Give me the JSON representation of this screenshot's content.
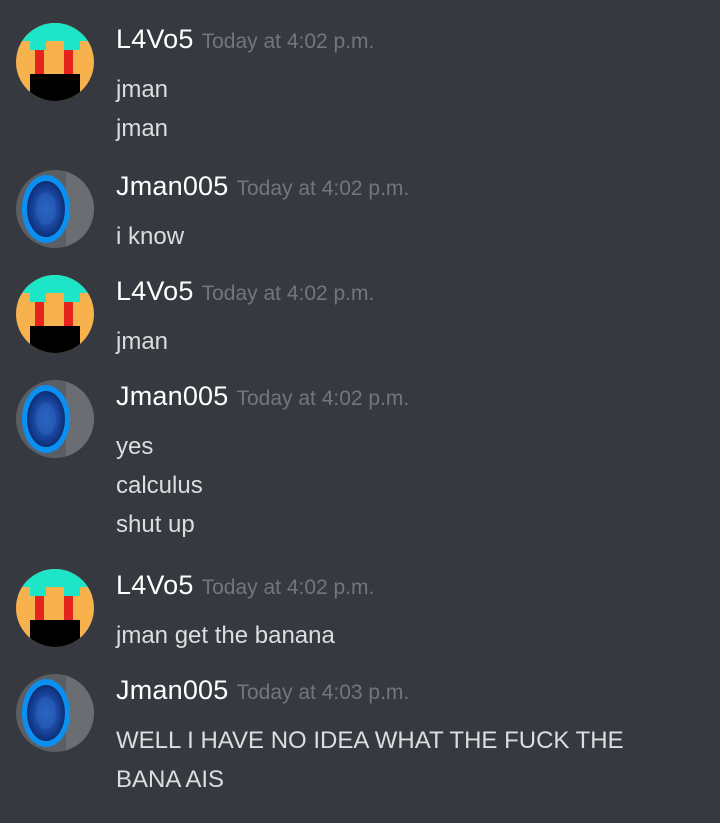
{
  "users": {
    "l4vo5": "L4Vo5",
    "jman": "Jman005"
  },
  "messages": [
    {
      "author": "L4Vo5",
      "timestamp": "Today at 4:02 p.m.",
      "avatar": "pixel-face-icon",
      "lines": [
        "jman",
        "jman"
      ]
    },
    {
      "author": "Jman005",
      "timestamp": "Today at 4:02 p.m.",
      "avatar": "blue-portal-icon",
      "lines": [
        "i know"
      ]
    },
    {
      "author": "L4Vo5",
      "timestamp": "Today at 4:02 p.m.",
      "avatar": "pixel-face-icon",
      "lines": [
        "jman"
      ]
    },
    {
      "author": "Jman005",
      "timestamp": "Today at 4:02 p.m.",
      "avatar": "blue-portal-icon",
      "lines": [
        "yes",
        "calculus",
        "shut up"
      ]
    },
    {
      "author": "L4Vo5",
      "timestamp": "Today at 4:02 p.m.",
      "avatar": "pixel-face-icon",
      "lines": [
        "jman get the banana"
      ]
    },
    {
      "author": "Jman005",
      "timestamp": "Today at 4:03 p.m.",
      "avatar": "blue-portal-icon",
      "lines": [
        "WELL I HAVE NO IDEA WHAT THE FUCK THE BANA AIS"
      ]
    }
  ],
  "colors": {
    "background": "#36393f",
    "username": "#ffffff",
    "timestamp": "#72767d",
    "message_text": "#dcddde"
  }
}
